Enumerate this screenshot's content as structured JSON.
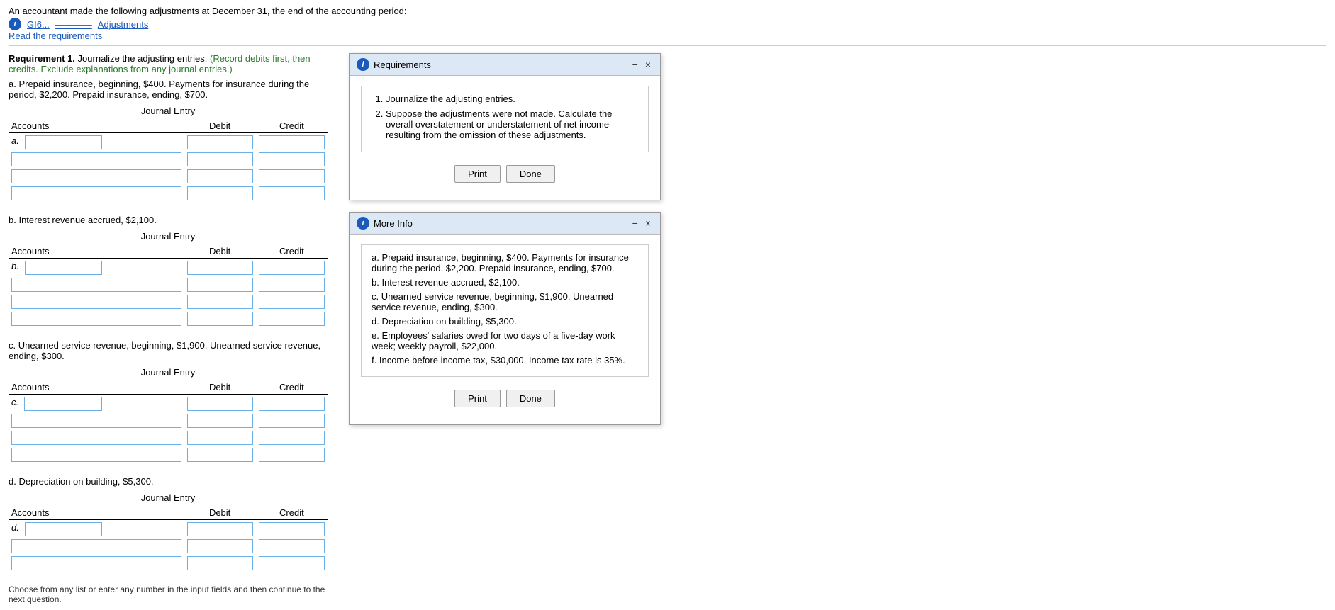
{
  "page": {
    "top_text": "An accountant made the following adjustments at December 31, the end of the accounting period:",
    "read_req": "Read the requirements",
    "divider": true
  },
  "requirement": {
    "label": "Requirement 1.",
    "title_text": "Journalize the adjusting entries.",
    "green_instruction": "(Record debits first, then credits. Exclude explanations from any journal entries.)",
    "bottom_note": "Choose from any list or enter any number in the input fields and then continue to the next question."
  },
  "sections": [
    {
      "id": "a",
      "label": "a.",
      "description": "a. Prepaid insurance, beginning, $400. Payments for insurance during the period, $2,200. Prepaid insurance, ending, $700.",
      "journal_title": "Journal Entry",
      "headers": [
        "Accounts",
        "Debit",
        "Credit"
      ],
      "rows": 4
    },
    {
      "id": "b",
      "label": "b.",
      "description": "b. Interest revenue accrued, $2,100.",
      "journal_title": "Journal Entry",
      "headers": [
        "Accounts",
        "Debit",
        "Credit"
      ],
      "rows": 4
    },
    {
      "id": "c",
      "label": "c.",
      "description": "c. Unearned service revenue, beginning, $1,900. Unearned service revenue, ending, $300.",
      "journal_title": "Journal Entry",
      "headers": [
        "Accounts",
        "Debit",
        "Credit"
      ],
      "rows": 4
    },
    {
      "id": "d",
      "label": "d.",
      "description": "d. Depreciation on building, $5,300.",
      "journal_title": "Journal Entry",
      "headers": [
        "Accounts",
        "Debit",
        "Credit"
      ],
      "rows": 3
    }
  ],
  "requirements_panel": {
    "title": "Requirements",
    "items": [
      "Journalize the adjusting entries.",
      "Suppose the adjustments were not made. Calculate the overall overstatement or understatement of net income resulting from the omission of these adjustments."
    ],
    "print_label": "Print",
    "done_label": "Done"
  },
  "more_info_panel": {
    "title": "More Info",
    "items": [
      {
        "key": "a",
        "text": "Prepaid insurance, beginning, $400. Payments for insurance during the period, $2,200. Prepaid insurance, ending, $700."
      },
      {
        "key": "b",
        "text": "Interest revenue accrued, $2,100."
      },
      {
        "key": "c",
        "text": "Unearned service revenue, beginning, $1,900. Unearned service revenue, ending, $300."
      },
      {
        "key": "d",
        "text": "Depreciation on building, $5,300."
      },
      {
        "key": "e",
        "text": "Employees' salaries owed for two days of a five-day work week; weekly payroll, $22,000."
      },
      {
        "key": "f",
        "text": "Income before income tax, $30,000. Income tax rate is 35%."
      }
    ],
    "print_label": "Print",
    "done_label": "Done"
  },
  "icons": {
    "info": "i",
    "minimize": "−",
    "close": "×"
  }
}
